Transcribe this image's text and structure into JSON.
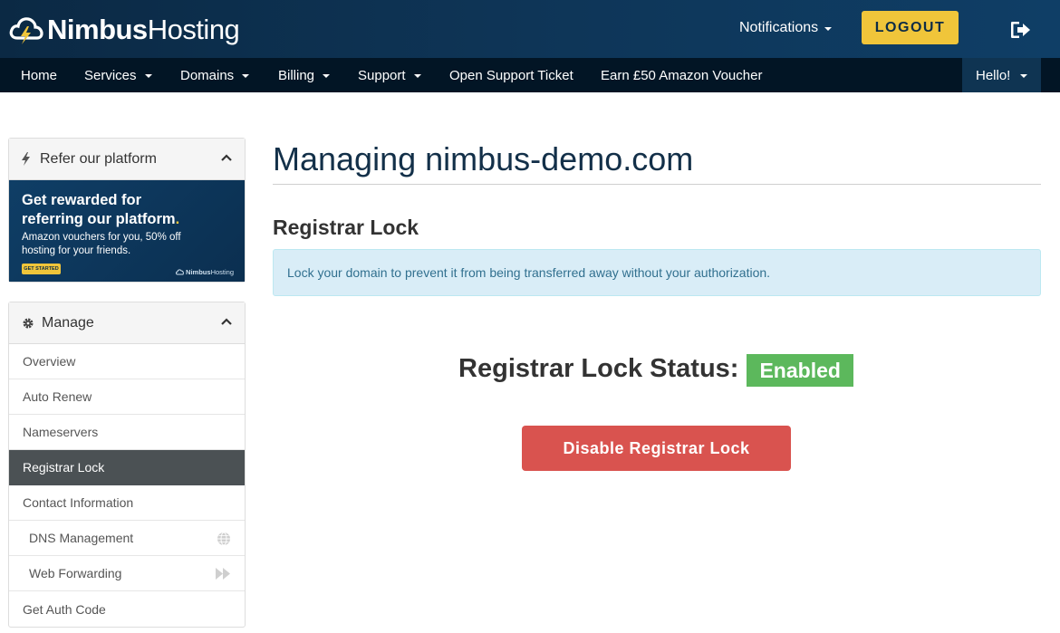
{
  "header": {
    "brand_bold": "Nimbus",
    "brand_light": "Hosting",
    "notifications_label": "Notifications",
    "logout_label": "LOGOUT"
  },
  "nav": {
    "items": [
      {
        "label": "Home",
        "has_caret": false
      },
      {
        "label": "Services",
        "has_caret": true
      },
      {
        "label": "Domains",
        "has_caret": true
      },
      {
        "label": "Billing",
        "has_caret": true
      },
      {
        "label": "Support",
        "has_caret": true
      },
      {
        "label": "Open Support Ticket",
        "has_caret": false
      },
      {
        "label": "Earn £50 Amazon Voucher",
        "has_caret": false
      }
    ],
    "user_label": "Hello!"
  },
  "sidebar": {
    "refer_panel": {
      "title": "Refer our platform",
      "promo_line1": "Get rewarded for",
      "promo_line2": "referring our platform",
      "promo_dot": ".",
      "promo_sub1": "Amazon vouchers for you, 50% off",
      "promo_sub2": "hosting for your friends.",
      "promo_button": "GET STARTED",
      "promo_brand_bold": "Nimbus",
      "promo_brand_light": "Hosting"
    },
    "manage_panel": {
      "title": "Manage",
      "items": [
        {
          "label": "Overview"
        },
        {
          "label": "Auto Renew"
        },
        {
          "label": "Nameservers"
        },
        {
          "label": "Registrar Lock",
          "active": true
        },
        {
          "label": "Contact Information"
        },
        {
          "label": "DNS Management",
          "icon": "globe-icon"
        },
        {
          "label": "Web Forwarding",
          "icon": "fast-forward-icon"
        },
        {
          "label": "Get Auth Code"
        }
      ]
    }
  },
  "main": {
    "title": "Managing nimbus-demo.com",
    "section_title": "Registrar Lock",
    "info_text": "Lock your domain to prevent it from being transferred away without your authorization.",
    "status_label": "Registrar Lock Status:",
    "status_value": "Enabled",
    "disable_button": "Disable Registrar Lock"
  },
  "colors": {
    "header_bg": "#0e3557",
    "nav_bg": "#021525",
    "accent_yellow": "#f0c53a",
    "success": "#5cb85c",
    "danger": "#d9534f",
    "info_bg": "#d9edf7",
    "info_text": "#31708f",
    "active_menu_bg": "#4b5154"
  }
}
